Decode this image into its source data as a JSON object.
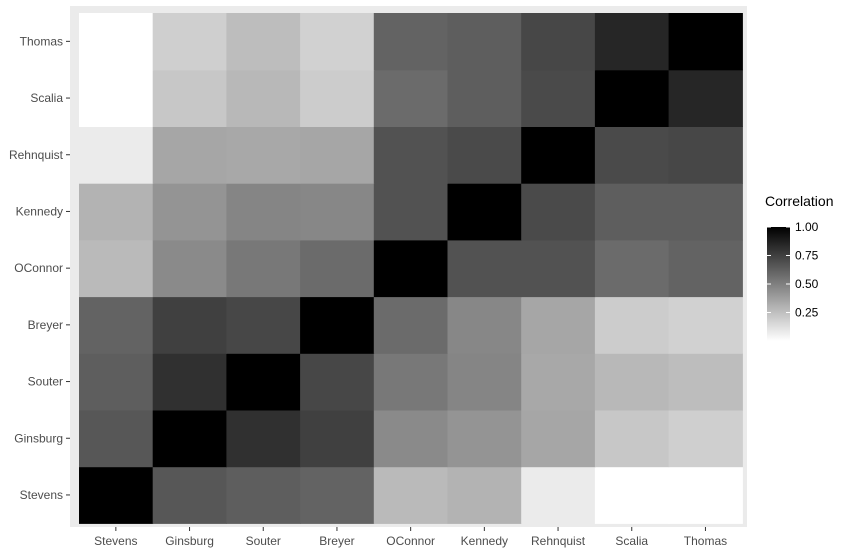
{
  "chart_data": {
    "type": "heatmap",
    "title": "",
    "xlabel": "",
    "ylabel": "",
    "x_categories": [
      "Stevens",
      "Ginsburg",
      "Souter",
      "Breyer",
      "OConnor",
      "Kennedy",
      "Rehnquist",
      "Scalia",
      "Thomas"
    ],
    "y_categories": [
      "Stevens",
      "Ginsburg",
      "Souter",
      "Breyer",
      "OConnor",
      "Kennedy",
      "Rehnquist",
      "Scalia",
      "Thomas"
    ],
    "values": [
      [
        1.0,
        0.66,
        0.63,
        0.61,
        0.27,
        0.3,
        0.08,
        0.0,
        0.0
      ],
      [
        0.66,
        1.0,
        0.81,
        0.75,
        0.46,
        0.42,
        0.35,
        0.22,
        0.19
      ],
      [
        0.63,
        0.81,
        1.0,
        0.72,
        0.53,
        0.48,
        0.34,
        0.28,
        0.26
      ],
      [
        0.61,
        0.75,
        0.72,
        1.0,
        0.58,
        0.47,
        0.35,
        0.2,
        0.18
      ],
      [
        0.27,
        0.46,
        0.53,
        0.58,
        1.0,
        0.68,
        0.68,
        0.58,
        0.61
      ],
      [
        0.3,
        0.42,
        0.48,
        0.47,
        0.68,
        1.0,
        0.71,
        0.63,
        0.63
      ],
      [
        0.08,
        0.35,
        0.34,
        0.35,
        0.68,
        0.71,
        1.0,
        0.71,
        0.72
      ],
      [
        0.0,
        0.22,
        0.28,
        0.2,
        0.58,
        0.63,
        0.71,
        1.0,
        0.85
      ],
      [
        0.0,
        0.19,
        0.26,
        0.18,
        0.61,
        0.63,
        0.72,
        0.85,
        1.0
      ]
    ],
    "legend": {
      "title": "Correlation",
      "ticks": [
        1.0,
        0.75,
        0.5,
        0.25
      ],
      "tick_labels": [
        "1.00",
        "0.75",
        "0.50",
        "0.25"
      ],
      "range": [
        0.0,
        1.0
      ],
      "placement": "right"
    },
    "colors": {
      "low": "#ffffff",
      "high": "#000000",
      "panel_background": "#ebebeb"
    },
    "grid": false
  }
}
